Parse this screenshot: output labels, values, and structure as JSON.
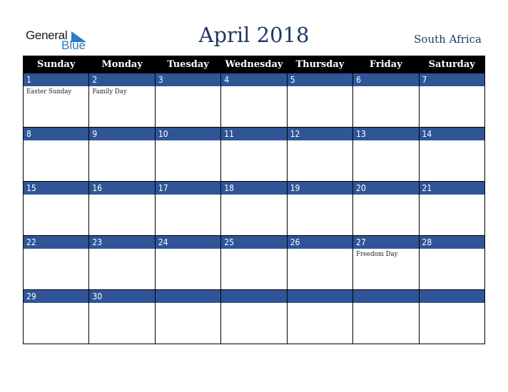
{
  "logo": {
    "word1": "General",
    "word2": "Blue",
    "icon": "blue-triangle-icon"
  },
  "title": "April 2018",
  "country": "South Africa",
  "colors": {
    "header_bg": "#000000",
    "number_bar": "#2f5597",
    "title": "#1f3864"
  },
  "weekdays": [
    "Sunday",
    "Monday",
    "Tuesday",
    "Wednesday",
    "Thursday",
    "Friday",
    "Saturday"
  ],
  "weeks": [
    [
      {
        "day": "1",
        "holiday": "Easter Sunday"
      },
      {
        "day": "2",
        "holiday": "Family Day"
      },
      {
        "day": "3",
        "holiday": ""
      },
      {
        "day": "4",
        "holiday": ""
      },
      {
        "day": "5",
        "holiday": ""
      },
      {
        "day": "6",
        "holiday": ""
      },
      {
        "day": "7",
        "holiday": ""
      }
    ],
    [
      {
        "day": "8",
        "holiday": ""
      },
      {
        "day": "9",
        "holiday": ""
      },
      {
        "day": "10",
        "holiday": ""
      },
      {
        "day": "11",
        "holiday": ""
      },
      {
        "day": "12",
        "holiday": ""
      },
      {
        "day": "13",
        "holiday": ""
      },
      {
        "day": "14",
        "holiday": ""
      }
    ],
    [
      {
        "day": "15",
        "holiday": ""
      },
      {
        "day": "16",
        "holiday": ""
      },
      {
        "day": "17",
        "holiday": ""
      },
      {
        "day": "18",
        "holiday": ""
      },
      {
        "day": "19",
        "holiday": ""
      },
      {
        "day": "20",
        "holiday": ""
      },
      {
        "day": "21",
        "holiday": ""
      }
    ],
    [
      {
        "day": "22",
        "holiday": ""
      },
      {
        "day": "23",
        "holiday": ""
      },
      {
        "day": "24",
        "holiday": ""
      },
      {
        "day": "25",
        "holiday": ""
      },
      {
        "day": "26",
        "holiday": ""
      },
      {
        "day": "27",
        "holiday": "Freedom Day"
      },
      {
        "day": "28",
        "holiday": ""
      }
    ],
    [
      {
        "day": "29",
        "holiday": ""
      },
      {
        "day": "30",
        "holiday": ""
      },
      {
        "day": "",
        "holiday": ""
      },
      {
        "day": "",
        "holiday": ""
      },
      {
        "day": "",
        "holiday": ""
      },
      {
        "day": "",
        "holiday": ""
      },
      {
        "day": "",
        "holiday": ""
      }
    ]
  ]
}
